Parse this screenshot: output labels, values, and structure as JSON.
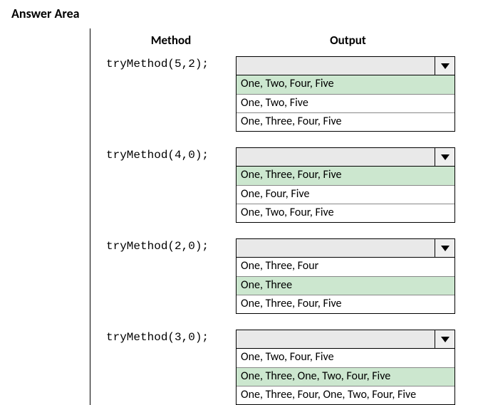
{
  "title": "Answer Area",
  "headers": {
    "method": "Method",
    "output": "Output"
  },
  "rows": [
    {
      "method": "tryMethod(5,2);",
      "selected": "",
      "options": [
        {
          "text": "One, Two, Four, Five",
          "correct": true
        },
        {
          "text": "One, Two, Five",
          "correct": false
        },
        {
          "text": "One, Three, Four, Five",
          "correct": false
        }
      ]
    },
    {
      "method": "tryMethod(4,0);",
      "selected": "",
      "options": [
        {
          "text": "One, Three, Four, Five",
          "correct": true
        },
        {
          "text": "One, Four, Five",
          "correct": false
        },
        {
          "text": "One, Two, Four, Five",
          "correct": false
        }
      ]
    },
    {
      "method": "tryMethod(2,0);",
      "selected": "",
      "options": [
        {
          "text": "One, Three, Four",
          "correct": false
        },
        {
          "text": "One, Three",
          "correct": true
        },
        {
          "text": "One, Three, Four, Five",
          "correct": false
        }
      ]
    },
    {
      "method": "tryMethod(3,0);",
      "selected": "",
      "options": [
        {
          "text": "One, Two, Four, Five",
          "correct": false
        },
        {
          "text": "One, Three, One, Two, Four, Five",
          "correct": true
        },
        {
          "text": "One, Three, Four, One, Two, Four, Five",
          "correct": false
        }
      ]
    }
  ]
}
